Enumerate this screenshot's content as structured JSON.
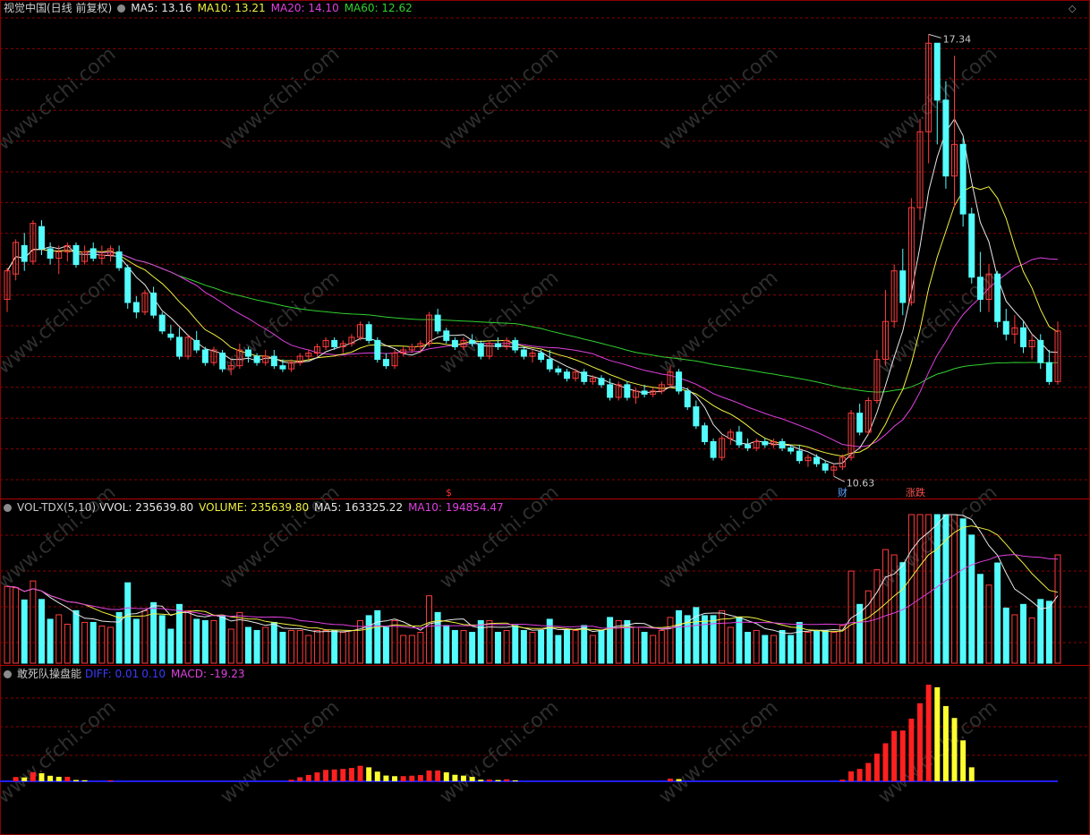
{
  "colors": {
    "up": "#ff3c3c",
    "down": "#54fcfc",
    "ma5": "#e8e8e8",
    "ma10": "#f0f040",
    "ma20": "#e040e0",
    "ma60": "#30d030",
    "macd_up": "#ff2020",
    "macd_fade": "#ffff30",
    "baseline": "#2020ff",
    "grid": "#8b0000"
  },
  "price_panel": {
    "stock": "视觉中国(日线 前复权)",
    "ma5": "MA5: 13.16",
    "ma10": "MA10: 13.21",
    "ma20": "MA20: 14.10",
    "ma60": "MA60: 12.62",
    "high_label": "17.34",
    "low_label": "10.63",
    "markers": [
      "$",
      "财",
      "涨跌"
    ]
  },
  "vol_panel": {
    "name": "VOL-TDX(5,10)",
    "vvol": "VVOL: 235639.80",
    "volume": "VOLUME: 235639.80",
    "ma5": "MA5: 163325.22",
    "ma10": "MA10: 194854.47"
  },
  "macd_panel": {
    "name": "敢死队操盘能",
    "diff": "DIFF: 0.01",
    "dea": "0.10",
    "macd": "MACD: -19.23"
  },
  "watermark": "www.cfchi.com",
  "chart_data": {
    "type": "candlestick",
    "title": "视觉中国(日线 前复权)",
    "price_range": [
      10.1,
      17.6
    ],
    "candles": [
      [
        13.15,
        13.65,
        12.95,
        13.6
      ],
      [
        13.55,
        14.1,
        13.45,
        14.05
      ],
      [
        14.0,
        14.2,
        13.6,
        13.75
      ],
      [
        13.75,
        14.4,
        13.7,
        14.35
      ],
      [
        14.3,
        14.4,
        13.85,
        13.95
      ],
      [
        13.95,
        14.05,
        13.7,
        13.8
      ],
      [
        13.8,
        14.0,
        13.55,
        13.9
      ],
      [
        13.9,
        14.05,
        13.75,
        14.0
      ],
      [
        14.0,
        14.05,
        13.65,
        13.7
      ],
      [
        13.75,
        14.0,
        13.7,
        13.9
      ],
      [
        13.95,
        14.05,
        13.75,
        13.8
      ],
      [
        13.8,
        14.0,
        13.7,
        13.85
      ],
      [
        13.85,
        14.0,
        13.75,
        13.95
      ],
      [
        13.9,
        14.0,
        13.6,
        13.65
      ],
      [
        13.65,
        13.7,
        13.0,
        13.1
      ],
      [
        13.1,
        13.2,
        12.85,
        12.95
      ],
      [
        12.95,
        13.3,
        12.9,
        13.25
      ],
      [
        13.25,
        13.35,
        12.85,
        12.9
      ],
      [
        12.9,
        12.95,
        12.6,
        12.65
      ],
      [
        12.6,
        12.75,
        12.5,
        12.55
      ],
      [
        12.55,
        12.7,
        12.2,
        12.25
      ],
      [
        12.25,
        12.6,
        12.2,
        12.55
      ],
      [
        12.5,
        12.65,
        12.3,
        12.35
      ],
      [
        12.35,
        12.4,
        12.1,
        12.15
      ],
      [
        12.15,
        12.4,
        12.1,
        12.35
      ],
      [
        12.3,
        12.35,
        12.0,
        12.05
      ],
      [
        12.05,
        12.2,
        11.95,
        12.1
      ],
      [
        12.1,
        12.45,
        12.05,
        12.35
      ],
      [
        12.35,
        12.4,
        12.15,
        12.25
      ],
      [
        12.25,
        12.3,
        12.1,
        12.15
      ],
      [
        12.15,
        12.35,
        12.1,
        12.25
      ],
      [
        12.25,
        12.35,
        12.05,
        12.1
      ],
      [
        12.1,
        12.2,
        12.0,
        12.05
      ],
      [
        12.05,
        12.2,
        12.0,
        12.15
      ],
      [
        12.15,
        12.3,
        12.1,
        12.25
      ],
      [
        12.25,
        12.35,
        12.2,
        12.3
      ],
      [
        12.3,
        12.45,
        12.25,
        12.4
      ],
      [
        12.4,
        12.55,
        12.35,
        12.5
      ],
      [
        12.5,
        12.55,
        12.35,
        12.4
      ],
      [
        12.4,
        12.5,
        12.3,
        12.45
      ],
      [
        12.45,
        12.6,
        12.4,
        12.55
      ],
      [
        12.55,
        12.8,
        12.5,
        12.75
      ],
      [
        12.75,
        12.8,
        12.45,
        12.5
      ],
      [
        12.5,
        12.55,
        12.15,
        12.2
      ],
      [
        12.2,
        12.3,
        12.05,
        12.1
      ],
      [
        12.1,
        12.35,
        12.05,
        12.3
      ],
      [
        12.3,
        12.4,
        12.25,
        12.35
      ],
      [
        12.35,
        12.45,
        12.3,
        12.4
      ],
      [
        12.4,
        12.5,
        12.3,
        12.45
      ],
      [
        12.45,
        12.95,
        12.4,
        12.9
      ],
      [
        12.9,
        13.0,
        12.6,
        12.65
      ],
      [
        12.65,
        12.7,
        12.45,
        12.5
      ],
      [
        12.5,
        12.55,
        12.35,
        12.4
      ],
      [
        12.4,
        12.55,
        12.35,
        12.5
      ],
      [
        12.5,
        12.6,
        12.4,
        12.45
      ],
      [
        12.45,
        12.5,
        12.2,
        12.25
      ],
      [
        12.25,
        12.5,
        12.2,
        12.45
      ],
      [
        12.45,
        12.55,
        12.35,
        12.4
      ],
      [
        12.4,
        12.55,
        12.35,
        12.5
      ],
      [
        12.5,
        12.55,
        12.3,
        12.35
      ],
      [
        12.35,
        12.4,
        12.2,
        12.25
      ],
      [
        12.25,
        12.35,
        12.15,
        12.3
      ],
      [
        12.3,
        12.35,
        12.15,
        12.2
      ],
      [
        12.2,
        12.35,
        12.0,
        12.05
      ],
      [
        12.05,
        12.1,
        11.95,
        12.0
      ],
      [
        12.0,
        12.05,
        11.85,
        11.9
      ],
      [
        11.9,
        12.05,
        11.85,
        12.0
      ],
      [
        12.0,
        12.05,
        11.8,
        11.85
      ],
      [
        11.85,
        11.95,
        11.8,
        11.9
      ],
      [
        11.9,
        11.95,
        11.75,
        11.8
      ],
      [
        11.8,
        11.9,
        11.55,
        11.6
      ],
      [
        11.6,
        11.85,
        11.55,
        11.8
      ],
      [
        11.8,
        11.85,
        11.55,
        11.6
      ],
      [
        11.6,
        11.75,
        11.5,
        11.7
      ],
      [
        11.7,
        11.8,
        11.6,
        11.65
      ],
      [
        11.65,
        11.75,
        11.6,
        11.7
      ],
      [
        11.7,
        11.85,
        11.65,
        11.8
      ],
      [
        11.8,
        12.1,
        11.75,
        12.0
      ],
      [
        12.0,
        12.05,
        11.65,
        11.7
      ],
      [
        11.7,
        11.75,
        11.4,
        11.45
      ],
      [
        11.45,
        11.55,
        11.1,
        11.15
      ],
      [
        11.15,
        11.2,
        10.85,
        10.9
      ],
      [
        10.9,
        10.95,
        10.6,
        10.65
      ],
      [
        10.65,
        11.0,
        10.6,
        10.95
      ],
      [
        10.95,
        11.1,
        10.85,
        11.05
      ],
      [
        11.05,
        11.15,
        10.8,
        10.85
      ],
      [
        10.85,
        10.95,
        10.75,
        10.8
      ],
      [
        10.8,
        10.95,
        10.75,
        10.9
      ],
      [
        10.9,
        10.95,
        10.8,
        10.85
      ],
      [
        10.85,
        10.95,
        10.8,
        10.9
      ],
      [
        10.9,
        10.95,
        10.75,
        10.8
      ],
      [
        10.8,
        10.85,
        10.7,
        10.75
      ],
      [
        10.75,
        10.85,
        10.55,
        10.6
      ],
      [
        10.6,
        10.7,
        10.5,
        10.65
      ],
      [
        10.65,
        10.7,
        10.5,
        10.55
      ],
      [
        10.55,
        10.6,
        10.4,
        10.45
      ],
      [
        10.45,
        10.55,
        10.35,
        10.5
      ],
      [
        10.5,
        10.7,
        10.45,
        10.65
      ],
      [
        10.65,
        11.4,
        10.6,
        11.35
      ],
      [
        11.35,
        11.5,
        11.0,
        11.05
      ],
      [
        11.05,
        11.6,
        11.0,
        11.55
      ],
      [
        11.55,
        12.35,
        11.5,
        12.2
      ],
      [
        12.2,
        13.3,
        12.1,
        12.8
      ],
      [
        12.8,
        13.7,
        12.7,
        13.6
      ],
      [
        13.6,
        13.95,
        12.9,
        13.1
      ],
      [
        13.1,
        14.75,
        13.05,
        14.6
      ],
      [
        14.6,
        16.0,
        14.4,
        15.8
      ],
      [
        15.8,
        17.34,
        15.3,
        17.2
      ],
      [
        17.2,
        17.2,
        15.6,
        16.3
      ],
      [
        16.3,
        16.6,
        14.9,
        15.1
      ],
      [
        15.1,
        17.0,
        14.6,
        15.6
      ],
      [
        15.6,
        15.7,
        14.3,
        14.5
      ],
      [
        14.5,
        14.6,
        13.4,
        13.5
      ],
      [
        13.5,
        13.9,
        12.95,
        13.15
      ],
      [
        13.15,
        13.7,
        12.95,
        13.55
      ],
      [
        13.55,
        13.6,
        12.7,
        12.8
      ],
      [
        12.8,
        13.0,
        12.5,
        12.6
      ],
      [
        12.6,
        12.9,
        12.45,
        12.7
      ],
      [
        12.7,
        12.8,
        12.3,
        12.4
      ],
      [
        12.4,
        12.6,
        12.2,
        12.5
      ],
      [
        12.5,
        12.6,
        12.05,
        12.15
      ],
      [
        12.15,
        12.35,
        11.8,
        11.85
      ],
      [
        11.85,
        12.8,
        11.8,
        12.65
      ]
    ],
    "ma_last": {
      "MA5": 13.16,
      "MA10": 13.21,
      "MA20": 14.1,
      "MA60": 12.62
    },
    "high": 17.34,
    "low": 10.63,
    "volume_ma": {
      "MA5": 163325.22,
      "MA10": 194854.47
    },
    "volume_last": 235639.8,
    "macd": {
      "DIFF": 0.01,
      "DEA": 0.1,
      "MACD": -19.23
    }
  }
}
